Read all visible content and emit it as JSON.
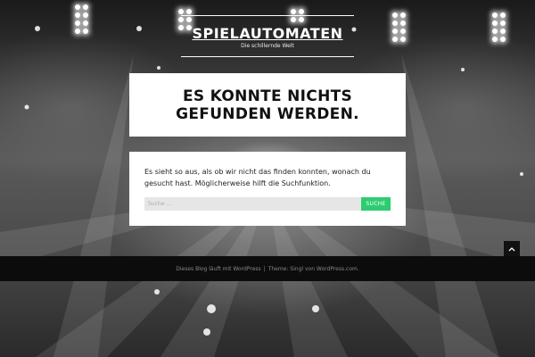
{
  "site": {
    "title": "SPIELAUTOMATEN",
    "description": "Die schillernde Welt"
  },
  "page": {
    "heading": "ES KONNTE NICHTS GEFUNDEN WERDEN.",
    "message": "Es sieht so aus, als ob wir nicht das finden konnten, wonach du gesucht hast. Möglicherweise hilft die Suchfunktion."
  },
  "search": {
    "placeholder": "Suche …",
    "button_label": "SUCHE"
  },
  "footer": {
    "blog_credit": "Dieses Blog läuft mit WordPress",
    "separator": "|",
    "theme_credit": "Theme: Singl von WordPress.com."
  },
  "icons": {
    "back_to_top": "chevron-up-icon"
  },
  "colors": {
    "accent": "#2ecc71",
    "footer_bg": "#0c0c0c"
  }
}
